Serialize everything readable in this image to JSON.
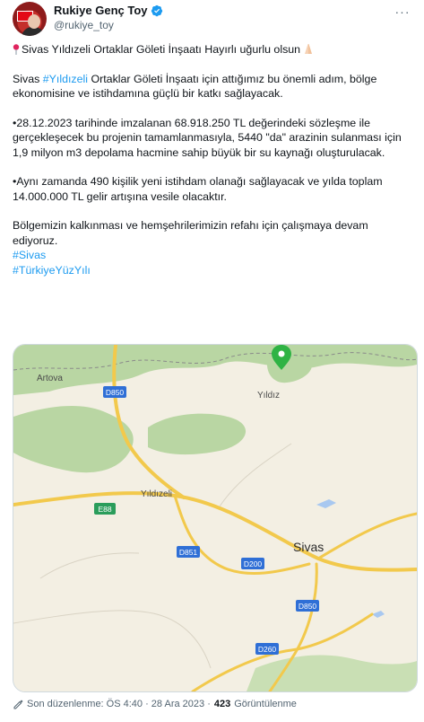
{
  "author": {
    "name": "Rukiye Genç Toy",
    "handle": "@rukiye_toy"
  },
  "tweet": {
    "line1": "Sivas Yıldızeli Ortaklar Göleti İnşaatı Hayırlı uğurlu olsun",
    "para2_a": "Sivas ",
    "para2_hashtag": "#Yıldızeli",
    "para2_b": " Ortaklar Göleti İnşaatı için attığımız bu önemli adım, bölge ekonomisine ve istihdamına güçlü bir katkı sağlayacak.",
    "para3": "•28.12.2023 tarihinde imzalanan 68.918.250 TL değerindeki sözleşme ile gerçekleşecek bu projenin tamamlanmasıyla, 5440 \"da\" arazinin sulanması için 1,9 milyon m3 depolama hacmine sahip büyük bir su kaynağı oluşturulacak.",
    "para4": " •Aynı zamanda 490 kişilik yeni istihdam olanağı sağlayacak ve yılda toplam 14.000.000 TL gelir artışına vesile olacaktır.",
    "para5": "Bölgemizin kalkınması ve hemşehrilerimizin refahı için çalışmaya devam ediyoruz.",
    "hashtag1": "#Sivas",
    "hashtag2": "#TürkiyeYüzYılı"
  },
  "map": {
    "labels": {
      "artova": "Artova",
      "yildiz": "Yıldız",
      "yildizeli": "Yıldızeli",
      "sivas": "Sivas"
    },
    "roads": {
      "d850_top": "D850",
      "e88": "E88",
      "d851": "D851",
      "d200": "D200",
      "d850_bottom": "D850",
      "d260": "D260"
    },
    "colors": {
      "land": "#f3efe3",
      "forest": "#b9d6a3",
      "road": "#f2c94c",
      "water": "#a8c8f0",
      "marker": "#2fb344",
      "shield_blue": "#2f6fd6",
      "shield_green": "#2a9d5b"
    }
  },
  "footer": {
    "edited": "Son düzenlenme: ÖS 4:40 · 28 Ara 2023 · ",
    "views_count": "423",
    "views_label": " Görüntülenme"
  }
}
